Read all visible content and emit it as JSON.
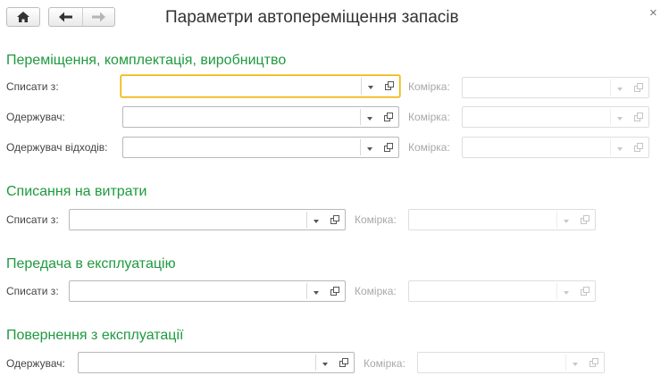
{
  "window": {
    "title": "Параметри автопереміщення запасів",
    "home_icon": "home-icon",
    "back_icon": "arrow-left-icon",
    "forward_icon": "arrow-right-icon",
    "close_glyph": "×"
  },
  "accent_color": "#1e9a3f",
  "focus_color": "#f0b400",
  "sections": {
    "moving": {
      "title": "Переміщення, комплектація, виробництво",
      "write_off_from": {
        "label": "Списати з:",
        "value": "",
        "cell_label": "Комірка:",
        "cell_value": ""
      },
      "recipient": {
        "label": "Одержувач:",
        "value": "",
        "cell_label": "Комірка:",
        "cell_value": ""
      },
      "waste_recipient": {
        "label": "Одержувач відходів:",
        "value": "",
        "cell_label": "Комірка:",
        "cell_value": ""
      }
    },
    "expenses": {
      "title": "Списання на витрати",
      "write_off_from": {
        "label": "Списати з:",
        "value": "",
        "cell_label": "Комірка:",
        "cell_value": ""
      }
    },
    "operation": {
      "title": "Передача в експлуатацію",
      "write_off_from": {
        "label": "Списати з:",
        "value": "",
        "cell_label": "Комірка:",
        "cell_value": ""
      }
    },
    "return": {
      "title": "Повернення з експлуатації",
      "recipient": {
        "label": "Одержувач:",
        "value": "",
        "cell_label": "Комірка:",
        "cell_value": ""
      }
    }
  }
}
